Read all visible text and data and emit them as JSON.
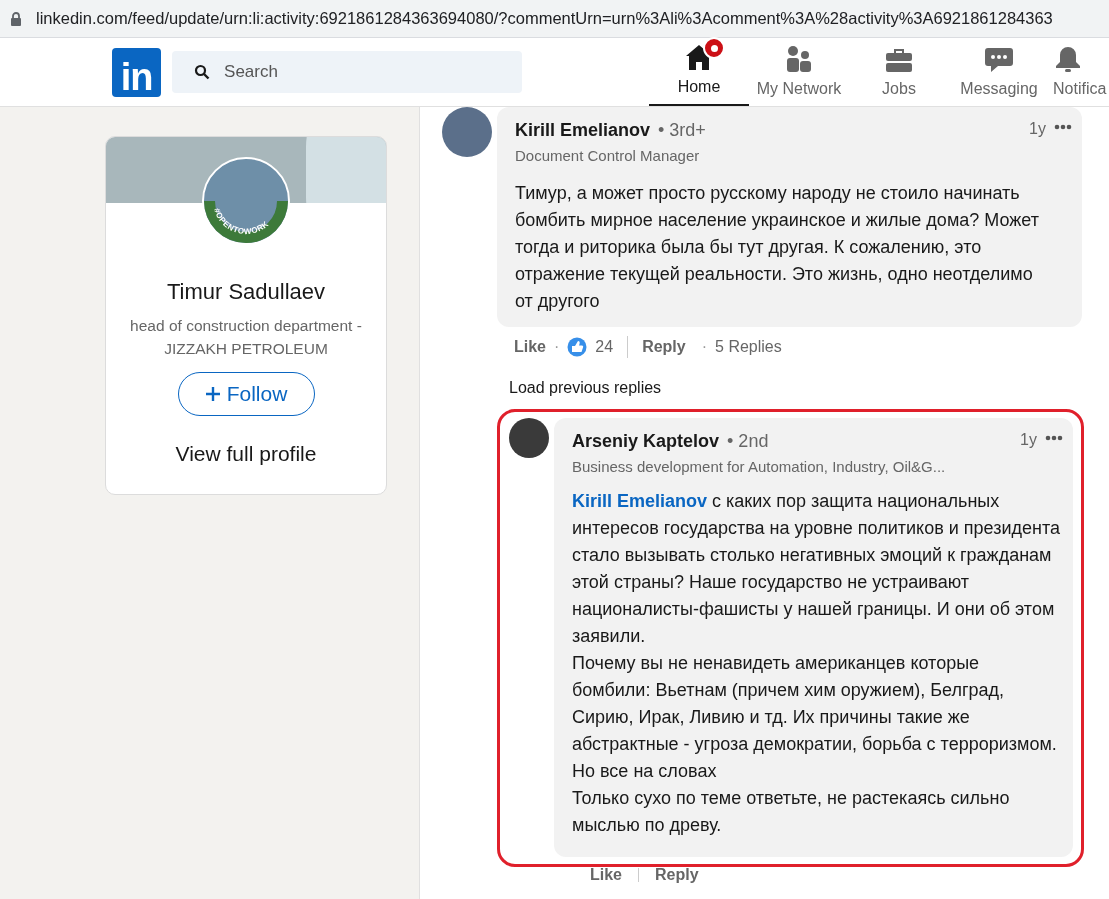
{
  "address_bar": {
    "url": "linkedin.com/feed/update/urn:li:activity:6921861284363694080/?commentUrn=urn%3Ali%3Acomment%3A%28activity%3A6921861284363"
  },
  "nav": {
    "logo": "in",
    "search": {
      "placeholder": "Search"
    },
    "items": [
      {
        "kind": "home",
        "label": "Home",
        "selected": true,
        "notification": true
      },
      {
        "kind": "network",
        "label": "My Network",
        "selected": false,
        "notification": false
      },
      {
        "kind": "jobs",
        "label": "Jobs",
        "selected": false,
        "notification": false
      },
      {
        "kind": "messaging",
        "label": "Messaging",
        "selected": false,
        "notification": false
      },
      {
        "kind": "notifications",
        "label": "Notifica",
        "selected": false,
        "notification": false
      }
    ]
  },
  "profile_card": {
    "badge": "#OPENTOWORK",
    "name": "Timur Sadullaev",
    "headline": "head of construction department - JIZZAKH PETROLEUM",
    "follow_button": "Follow",
    "view_profile": "View full profile"
  },
  "comment": {
    "author": "Kirill Emelianov",
    "degree": "• 3rd+",
    "headline": "Document Control Manager",
    "time": "1y",
    "paragraphs": [
      "Тимур, а может просто русскому народу не стоило начинать бомбить мирное население украинское и жилые дома? Может тогда и риторика была бы тут другая. К сожалению, это отражение текущей реальности. Это жизнь, одно неотделимо от другого"
    ],
    "actions": {
      "like": "Like",
      "separators": [
        "·",
        "·"
      ],
      "reactions": "24",
      "reply": "Reply",
      "replies": "5 Replies"
    }
  },
  "load_previous": "Load previous replies",
  "reply": {
    "author": "Arseniy Kaptelov",
    "degree": "• 2nd",
    "headline": "Business development for Automation, Industry, Oil&G...",
    "time": "1y",
    "highlighted": true,
    "mention": "Kirill Emelianov",
    "paragraphs": [
      "с каких пор защита национальных интересов государства на уровне политиков и президента стало вызывать столько негативных эмоций к гражданам этой страны? Наше государство не устраивают националисты-фашисты у нашей границы. И они об этом заявили.",
      "Почему вы не ненавидеть американцев которые бомбили: Вьетнам (причем хим оружием), Белград, Сирию, Ирак, Ливию и тд. Их причины такие же абстрактные - угроза демократии, борьба с терроризмом. Но все на словах",
      "Только сухо по теме ответьте, не растекаясь сильно мыслью по древу."
    ],
    "actions": {
      "like": "Like",
      "reply": "Reply"
    }
  }
}
